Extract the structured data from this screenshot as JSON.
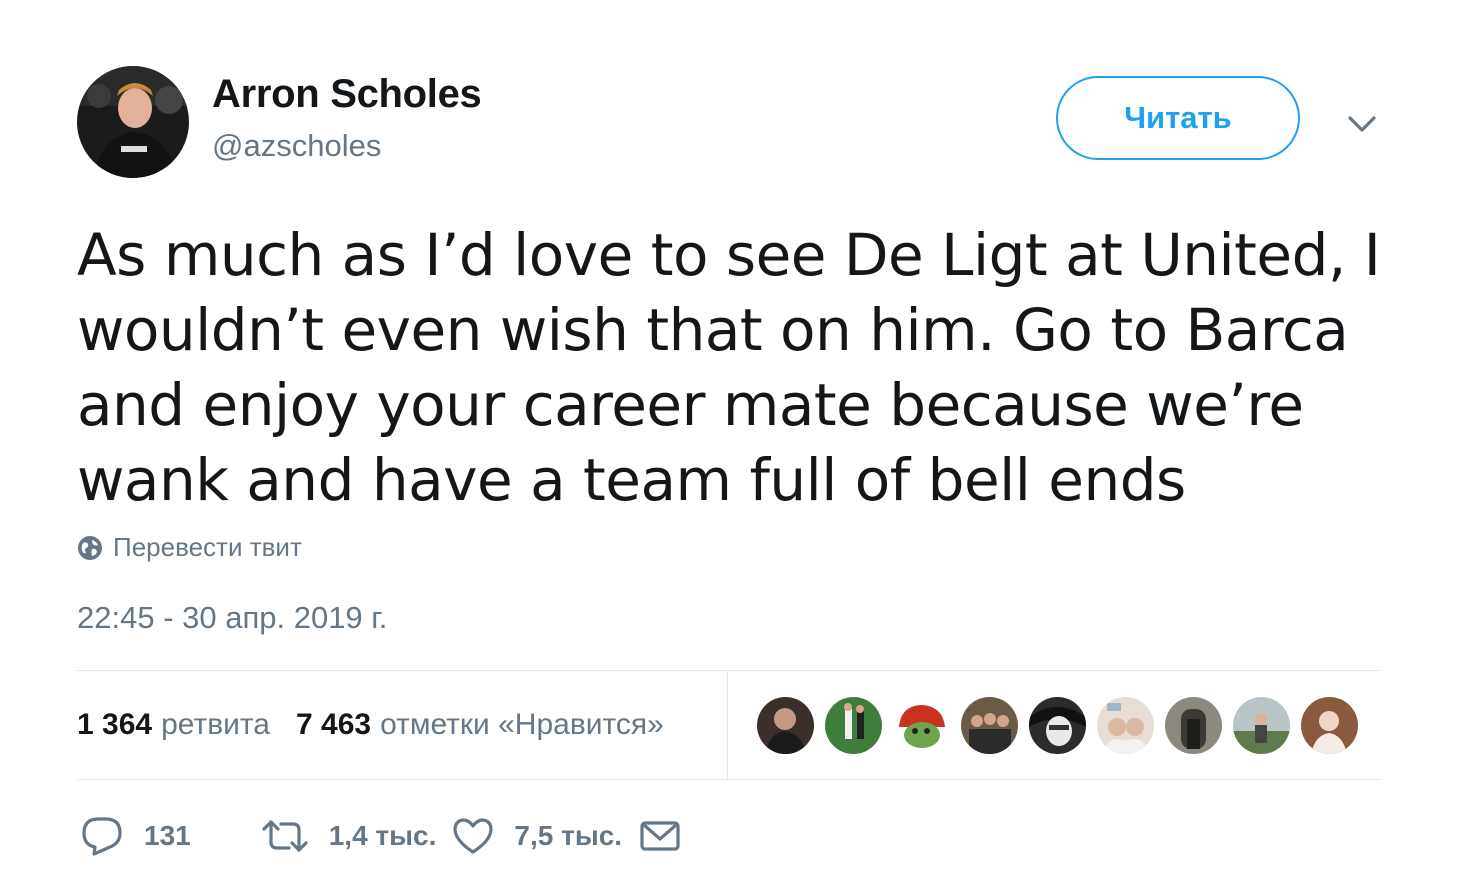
{
  "author": {
    "name": "Arron Scholes",
    "handle": "@azscholes",
    "avatar_icon": "user-avatar-photo"
  },
  "header": {
    "follow_label": "Читать",
    "caret_icon": "chevron-down-icon"
  },
  "tweet": {
    "text": "As much as I’d love to see De Ligt at United, I wouldn’t even wish that on him. Go to Barca and enjoy your career mate because we’re wank and have a team full of bell ends",
    "translate_label": "Перевести твит",
    "translate_icon": "globe-icon",
    "timestamp": "22:45 - 30 апр. 2019 г."
  },
  "stats": {
    "retweets_count": "1 364",
    "retweets_label": "ретвита",
    "likes_count": "7 463",
    "likes_label": "отметки «Нравится»"
  },
  "likers": [
    {
      "icon": "liker-avatar-1",
      "color": "#3a2f2a"
    },
    {
      "icon": "liker-avatar-2",
      "color": "#3f7d3a"
    },
    {
      "icon": "liker-avatar-3",
      "color": "#c8321e"
    },
    {
      "icon": "liker-avatar-4",
      "color": "#6a5a48"
    },
    {
      "icon": "liker-avatar-5",
      "color": "#2c2c2c"
    },
    {
      "icon": "liker-avatar-6",
      "color": "#d9b9a3"
    },
    {
      "icon": "liker-avatar-7",
      "color": "#5b5a52"
    },
    {
      "icon": "liker-avatar-8",
      "color": "#7f8a88"
    },
    {
      "icon": "liker-avatar-9",
      "color": "#8a5a3e"
    }
  ],
  "actions": {
    "reply_count": "131",
    "retweet_count": "1,4 тыс.",
    "like_count": "7,5 тыс.",
    "icons": [
      "reply-icon",
      "retweet-icon",
      "heart-icon",
      "direct-message-icon"
    ]
  },
  "colors": {
    "accent": "#1da1f2",
    "text_primary": "#14171a",
    "text_secondary": "#657786",
    "divider": "#e1e8ed"
  }
}
